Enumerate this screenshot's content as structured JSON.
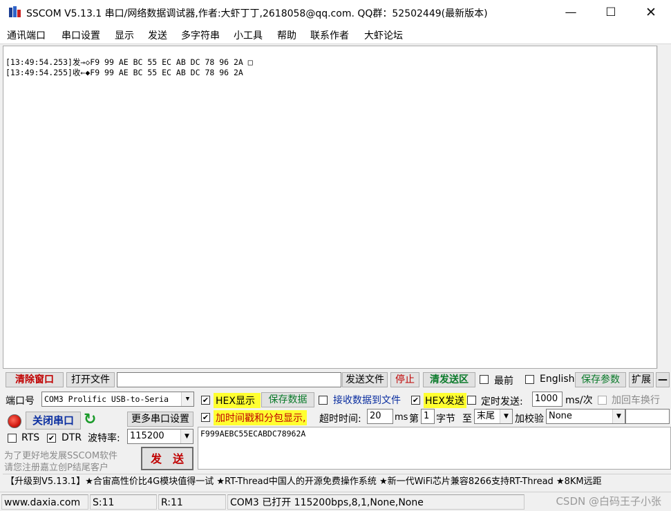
{
  "window": {
    "title": "SSCOM V5.13.1 串口/网络数据调试器,作者:大虾丁丁,2618058@qq.com. QQ群：52502449(最新版本)",
    "min_glyph": "—",
    "max_glyph": "☐",
    "close_glyph": "✕"
  },
  "menu": [
    "通讯端口",
    "串口设置",
    "显示",
    "发送",
    "多字符串",
    "小工具",
    "帮助",
    "联系作者",
    "大虾论坛"
  ],
  "receive": {
    "lines": [
      "[13:49:54.253]发→◇F9 99 AE BC 55 EC AB DC 78 96 2A □",
      "[13:49:54.255]收←◆F9 99 AE BC 55 EC AB DC 78 96 2A"
    ]
  },
  "toolbar": {
    "clear_window": "清除窗口",
    "open_file": "打开文件",
    "file_path": "",
    "send_file": "发送文件",
    "stop": "停止",
    "clear_send": "清发送区",
    "topmost": "最前",
    "english": "English",
    "save_params": "保存参数",
    "expand": "扩展",
    "collapse": "—"
  },
  "port": {
    "port_label": "端口号",
    "port_value": "COM3 Prolific USB-to-Seria",
    "close_port": "关闭串口",
    "more_settings": "更多串口设置",
    "rts": "RTS",
    "dtr": "DTR",
    "baud_label": "波特率:",
    "baud_value": "115200",
    "promo_line1": "为了更好地发展SSCOM软件",
    "promo_line2": "请您注册嘉立创P结尾客户",
    "send_button": "发　送"
  },
  "options": {
    "hex_display": "HEX显示",
    "save_data": "保存数据",
    "recv_to_file": "接收数据到文件",
    "hex_send": "HEX发送",
    "timed_send": "定时发送:",
    "interval": "1000",
    "interval_unit": "ms/次",
    "add_crlf": "加回车换行",
    "add_timestamp": "加时间戳和分包显示,",
    "timeout_label": "超时时间:",
    "timeout_value": "20",
    "timeout_unit": "ms",
    "nth_label": "第",
    "nth_value": "1",
    "byte_label": "字节",
    "to_label": "至",
    "end_value": "末尾",
    "checksum_label": "加校验",
    "checksum_value": "None"
  },
  "send_text": "F999AEBC55ECABDC78962A",
  "ticker": "【升级到V5.13.1】★合宙高性价比4G模块值得一试 ★RT-Thread中国人的开源免费操作系统 ★新一代WiFi芯片兼容8266支持RT-Thread ★8KM远距",
  "status": {
    "site": "www.daxia.com",
    "sent": "S:11",
    "received": "R:11",
    "port_status": "COM3 已打开  115200bps,8,1,None,None"
  },
  "watermark": "CSDN @白码王子小张",
  "colors": {
    "red_button_text": "#c00000",
    "green_text": "#0a7a2a",
    "blue_text": "#0a2ea0",
    "highlight": "#ffff30"
  }
}
